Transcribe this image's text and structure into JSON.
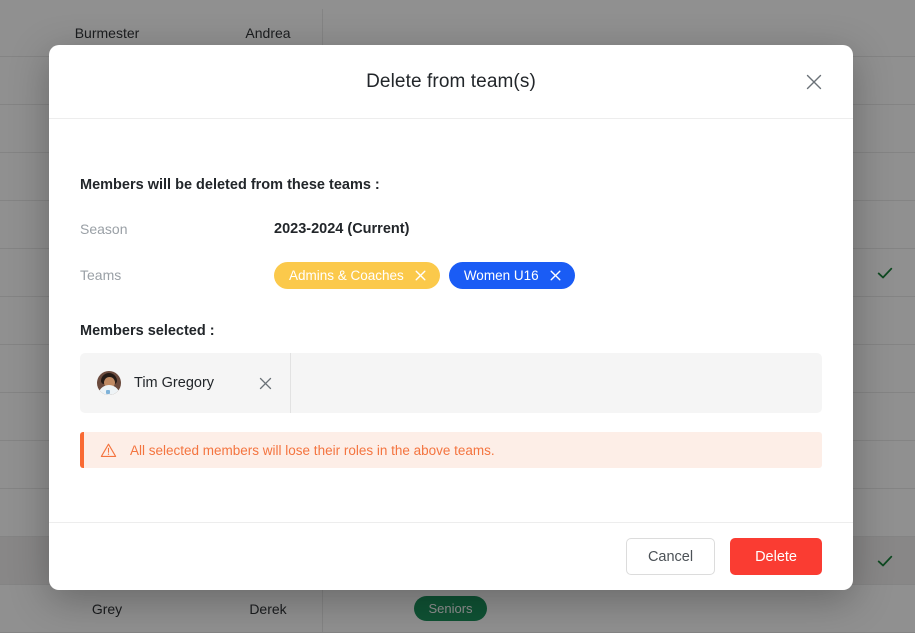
{
  "background_table": {
    "rows": [
      {
        "last_name": "Burmester",
        "first_name": "Andrea",
        "team": "",
        "checked": false,
        "highlight": false
      },
      {
        "last_name": "",
        "first_name": "",
        "team": "",
        "checked": false,
        "highlight": false
      },
      {
        "last_name": "",
        "first_name": "",
        "team": "",
        "checked": false,
        "highlight": false
      },
      {
        "last_name": "",
        "first_name": "",
        "team": "",
        "checked": false,
        "highlight": false
      },
      {
        "last_name": "",
        "first_name": "",
        "team": "",
        "checked": false,
        "highlight": false
      },
      {
        "last_name": "",
        "first_name": "",
        "team": "",
        "checked": true,
        "highlight": false
      },
      {
        "last_name": "",
        "first_name": "",
        "team": "",
        "checked": false,
        "highlight": false
      },
      {
        "last_name": "",
        "first_name": "",
        "team": "",
        "checked": false,
        "highlight": false
      },
      {
        "last_name": "",
        "first_name": "",
        "team": "",
        "checked": false,
        "highlight": false
      },
      {
        "last_name": "",
        "first_name": "",
        "team": "",
        "checked": false,
        "highlight": false
      },
      {
        "last_name": "",
        "first_name": "",
        "team": "",
        "checked": false,
        "highlight": false
      },
      {
        "last_name": "",
        "first_name": "",
        "team": "",
        "checked": true,
        "highlight": true
      },
      {
        "last_name": "Grey",
        "first_name": "Derek",
        "team": "Seniors",
        "checked": false,
        "highlight": false
      }
    ],
    "team_chip_color": "#0c8a52",
    "check_color": "#0b7a2e"
  },
  "modal": {
    "title": "Delete from team(s)",
    "close_icon": "close-icon",
    "intro_text": "Members will be deleted from these teams :",
    "fields": [
      {
        "label": "Season",
        "value": "2023-2024 (Current)"
      }
    ],
    "teams_label": "Teams",
    "team_chips": [
      {
        "label": "Admins & Coaches",
        "color": "#fbc94b"
      },
      {
        "label": "Women U16",
        "color": "#1a5cf5"
      }
    ],
    "members_title": "Members selected :",
    "members": [
      {
        "name": "Tim Gregory",
        "avatar": "user-avatar"
      }
    ],
    "warning": {
      "icon": "warning-triangle-icon",
      "text": "All selected members will lose their roles in the above teams.",
      "accent_color": "#f96a33",
      "background_color": "#fdeee7"
    },
    "footer": {
      "cancel_label": "Cancel",
      "delete_label": "Delete",
      "delete_color": "#fa3c32"
    }
  }
}
